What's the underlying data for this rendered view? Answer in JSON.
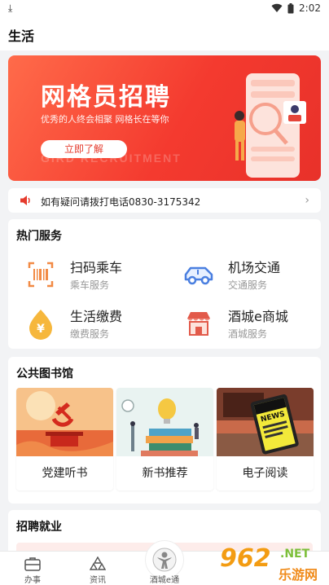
{
  "status": {
    "time": "2:02",
    "download_icon": "download-icon",
    "wifi_icon": "wifi-icon",
    "battery_icon": "battery-icon"
  },
  "header": {
    "title": "生活"
  },
  "banner": {
    "title": "网格员招聘",
    "subtitle": "优秀的人终会相聚 网格长在等你",
    "bg_text": "GIRD RECRUITMENT",
    "button_label": "立即了解",
    "colors": {
      "start": "#ff6b4a",
      "end": "#e8312a"
    }
  },
  "notice": {
    "text": "如有疑问请拨打电话0830-3175342"
  },
  "hot_services": {
    "title": "热门服务",
    "items": [
      {
        "name": "扫码乘车",
        "sub": "乘车服务",
        "icon": "barcode-icon"
      },
      {
        "name": "机场交通",
        "sub": "交通服务",
        "icon": "car-icon"
      },
      {
        "name": "生活缴费",
        "sub": "缴费服务",
        "icon": "yen-drop-icon"
      },
      {
        "name": "酒城e商城",
        "sub": "酒城服务",
        "icon": "shop-icon"
      }
    ]
  },
  "library": {
    "title": "公共图书馆",
    "items": [
      {
        "label": "党建听书"
      },
      {
        "label": "新书推荐"
      },
      {
        "label": "电子阅读",
        "badge_text": "NEWS"
      }
    ]
  },
  "jobs": {
    "title": "招聘就业"
  },
  "tabbar": {
    "items": [
      {
        "label": "办事",
        "icon": "briefcase-icon"
      },
      {
        "label": "资讯",
        "icon": "triangles-icon"
      },
      {
        "label": "酒城e通",
        "icon": "person-logo-icon"
      }
    ]
  },
  "watermark": {
    "num": "962",
    "net": ".NET",
    "cn": "乐游网"
  }
}
